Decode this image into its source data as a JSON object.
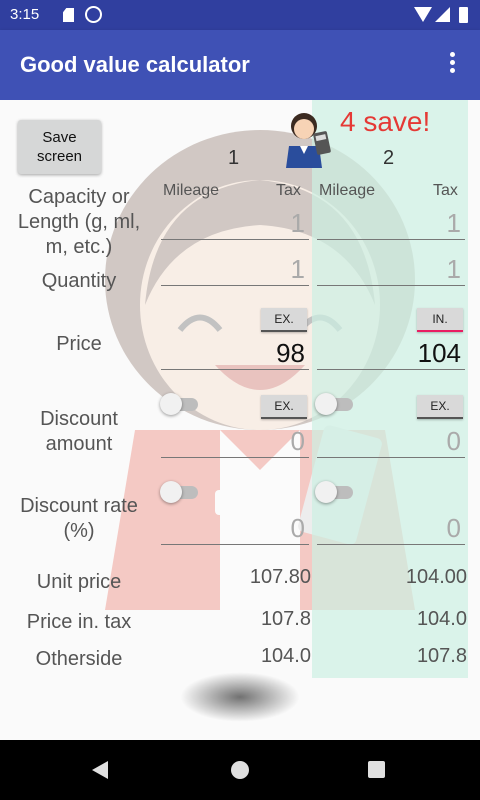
{
  "status_bar": {
    "time": "3:15"
  },
  "app_bar": {
    "title": "Good value calculator",
    "menu_icon": "more-vert-icon"
  },
  "save_button": {
    "label_line1": "Save",
    "label_line2": "screen"
  },
  "result": {
    "message": "4 save!",
    "color": "#e53935"
  },
  "columns": [
    {
      "number": "1",
      "mileage_label": "Mileage",
      "tax_label": "Tax"
    },
    {
      "number": "2",
      "mileage_label": "Mileage",
      "tax_label": "Tax"
    }
  ],
  "labels": {
    "capacity": [
      "Capacity or",
      "Length (g, ml,",
      "m, etc.)"
    ],
    "quantity": "Quantity",
    "price": "Price",
    "discount_amount": [
      "Discount",
      "amount"
    ],
    "discount_rate": [
      "Discount rate",
      "(%)"
    ],
    "unit_price": "Unit price",
    "price_in_tax": "Price in. tax",
    "otherside": "Otherside"
  },
  "col1": {
    "capacity": "1",
    "quantity": "1",
    "price_tax_mode": "EX.",
    "price": "98",
    "discount_tax_mode": "EX.",
    "discount_amount": "0",
    "discount_rate": "0",
    "unit_price": "107.80",
    "price_in_tax": "107.8",
    "otherside": "104.0"
  },
  "col2": {
    "capacity": "1",
    "quantity": "1",
    "price_tax_mode": "IN.",
    "price": "104",
    "discount_tax_mode": "EX.",
    "discount_amount": "0",
    "discount_rate": "0",
    "unit_price": "104.00",
    "price_in_tax": "104.0",
    "otherside": "107.8"
  },
  "colors": {
    "primary": "#3f51b5",
    "primary_dark": "#303f9f",
    "accent": "#e91e63",
    "col2_bg": "#ccefe3"
  }
}
